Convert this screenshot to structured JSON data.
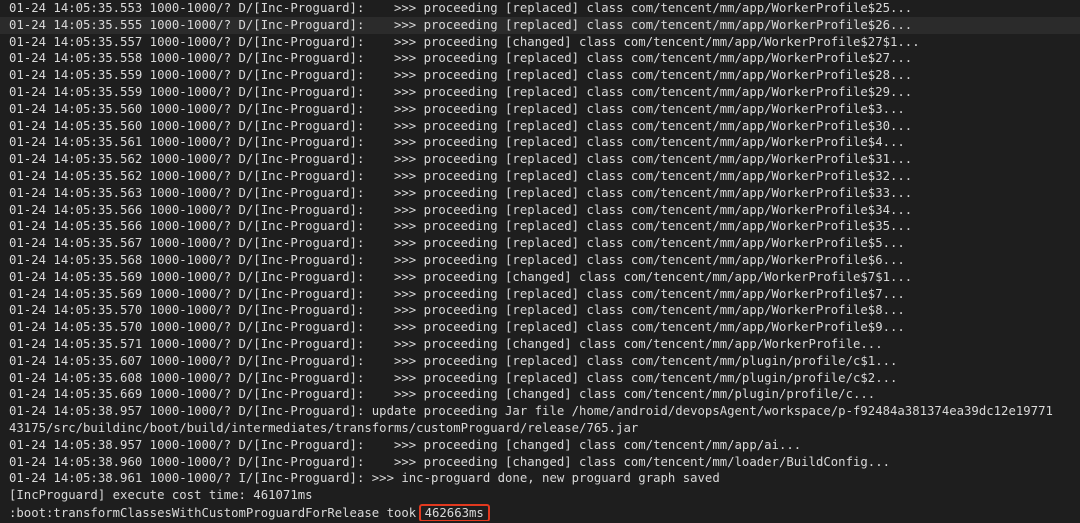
{
  "terminal": {
    "lines": [
      "01-24 14:05:35.553 1000-1000/? D/[Inc-Proguard]:    >>> proceeding [replaced] class com/tencent/mm/app/WorkerProfile$25...",
      "01-24 14:05:35.555 1000-1000/? D/[Inc-Proguard]:    >>> proceeding [replaced] class com/tencent/mm/app/WorkerProfile$26...",
      "01-24 14:05:35.557 1000-1000/? D/[Inc-Proguard]:    >>> proceeding [changed] class com/tencent/mm/app/WorkerProfile$27$1...",
      "01-24 14:05:35.558 1000-1000/? D/[Inc-Proguard]:    >>> proceeding [replaced] class com/tencent/mm/app/WorkerProfile$27...",
      "01-24 14:05:35.559 1000-1000/? D/[Inc-Proguard]:    >>> proceeding [replaced] class com/tencent/mm/app/WorkerProfile$28...",
      "01-24 14:05:35.559 1000-1000/? D/[Inc-Proguard]:    >>> proceeding [replaced] class com/tencent/mm/app/WorkerProfile$29...",
      "01-24 14:05:35.560 1000-1000/? D/[Inc-Proguard]:    >>> proceeding [replaced] class com/tencent/mm/app/WorkerProfile$3...",
      "01-24 14:05:35.560 1000-1000/? D/[Inc-Proguard]:    >>> proceeding [replaced] class com/tencent/mm/app/WorkerProfile$30...",
      "01-24 14:05:35.561 1000-1000/? D/[Inc-Proguard]:    >>> proceeding [replaced] class com/tencent/mm/app/WorkerProfile$4...",
      "01-24 14:05:35.562 1000-1000/? D/[Inc-Proguard]:    >>> proceeding [replaced] class com/tencent/mm/app/WorkerProfile$31...",
      "01-24 14:05:35.562 1000-1000/? D/[Inc-Proguard]:    >>> proceeding [replaced] class com/tencent/mm/app/WorkerProfile$32...",
      "01-24 14:05:35.563 1000-1000/? D/[Inc-Proguard]:    >>> proceeding [replaced] class com/tencent/mm/app/WorkerProfile$33...",
      "01-24 14:05:35.566 1000-1000/? D/[Inc-Proguard]:    >>> proceeding [replaced] class com/tencent/mm/app/WorkerProfile$34...",
      "01-24 14:05:35.566 1000-1000/? D/[Inc-Proguard]:    >>> proceeding [replaced] class com/tencent/mm/app/WorkerProfile$35...",
      "01-24 14:05:35.567 1000-1000/? D/[Inc-Proguard]:    >>> proceeding [replaced] class com/tencent/mm/app/WorkerProfile$5...",
      "01-24 14:05:35.568 1000-1000/? D/[Inc-Proguard]:    >>> proceeding [replaced] class com/tencent/mm/app/WorkerProfile$6...",
      "01-24 14:05:35.569 1000-1000/? D/[Inc-Proguard]:    >>> proceeding [changed] class com/tencent/mm/app/WorkerProfile$7$1...",
      "01-24 14:05:35.569 1000-1000/? D/[Inc-Proguard]:    >>> proceeding [replaced] class com/tencent/mm/app/WorkerProfile$7...",
      "01-24 14:05:35.570 1000-1000/? D/[Inc-Proguard]:    >>> proceeding [replaced] class com/tencent/mm/app/WorkerProfile$8...",
      "01-24 14:05:35.570 1000-1000/? D/[Inc-Proguard]:    >>> proceeding [replaced] class com/tencent/mm/app/WorkerProfile$9...",
      "01-24 14:05:35.571 1000-1000/? D/[Inc-Proguard]:    >>> proceeding [changed] class com/tencent/mm/app/WorkerProfile...",
      "01-24 14:05:35.607 1000-1000/? D/[Inc-Proguard]:    >>> proceeding [replaced] class com/tencent/mm/plugin/profile/c$1...",
      "01-24 14:05:35.608 1000-1000/? D/[Inc-Proguard]:    >>> proceeding [replaced] class com/tencent/mm/plugin/profile/c$2...",
      "01-24 14:05:35.669 1000-1000/? D/[Inc-Proguard]:    >>> proceeding [changed] class com/tencent/mm/plugin/profile/c...",
      "01-24 14:05:38.957 1000-1000/? D/[Inc-Proguard]: update proceeding Jar file /home/android/devopsAgent/workspace/p-f92484a381374ea39dc12e19771",
      "43175/src/buildinc/boot/build/intermediates/transforms/customProguard/release/765.jar",
      "01-24 14:05:38.957 1000-1000/? D/[Inc-Proguard]:    >>> proceeding [changed] class com/tencent/mm/app/ai...",
      "01-24 14:05:38.960 1000-1000/? D/[Inc-Proguard]:    >>> proceeding [changed] class com/tencent/mm/loader/BuildConfig...",
      "01-24 14:05:38.961 1000-1000/? I/[Inc-Proguard]: >>> inc-proguard done, new proguard graph saved",
      "[IncProguard] execute cost time: 461071ms"
    ],
    "final_line_prefix": ":boot:transformClassesWithCustomProguardForRelease took ",
    "final_line_time": "462663ms",
    "highlight_color": "#e2391f",
    "background_color": "#1e1e1e"
  }
}
